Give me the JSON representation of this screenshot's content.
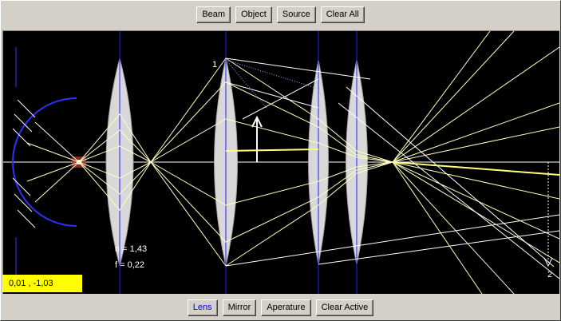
{
  "toolbar_top": {
    "beam": "Beam",
    "object": "Object",
    "source": "Source",
    "clear_all": "Clear All"
  },
  "toolbar_bottom": {
    "lens": "Lens",
    "mirror": "Mirror",
    "aperture": "Aperature",
    "clear_active": "Clear Active",
    "active_tool": "Lens"
  },
  "canvas": {
    "n_label": "n = 1,43",
    "f_label": "f = 0,22",
    "marker_1": "1",
    "marker_2": "2"
  },
  "status": {
    "coordinates": "0,01 , -1,03"
  },
  "colors": {
    "background": "#000000",
    "lens_fill": "#d8d8d8",
    "axis": "#2020ff",
    "ray": "#ffffc0",
    "mirror": "#2020ff",
    "coords_bg": "#ffff00",
    "active_button_text": "#0000ee"
  }
}
